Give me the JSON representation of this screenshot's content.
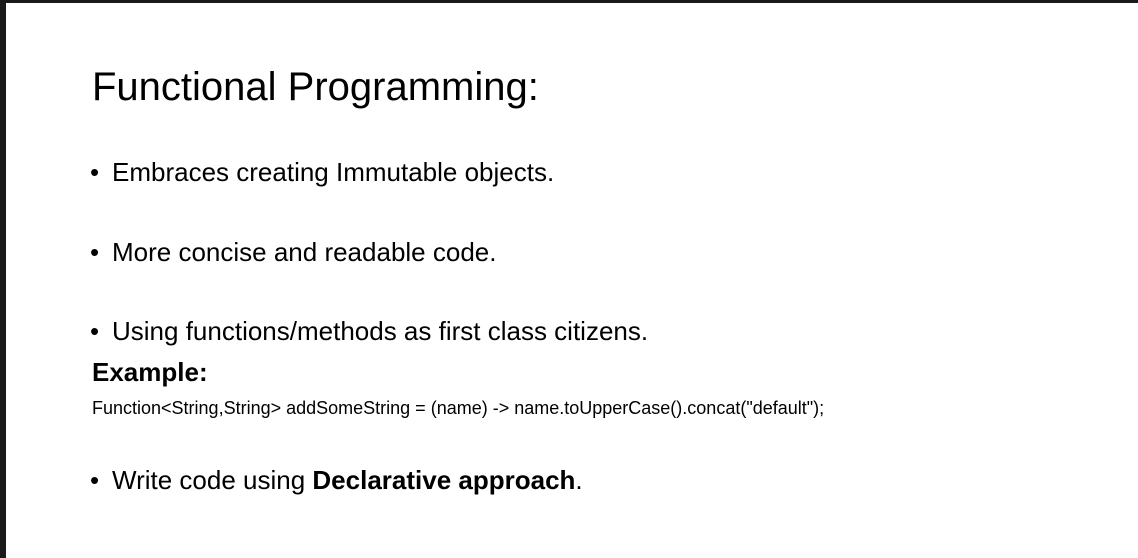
{
  "slide": {
    "title": "Functional Programming:",
    "bullets": [
      "Embraces creating Immutable objects.",
      "More concise and readable code.",
      "Using functions/methods as first class citizens."
    ],
    "example_label": "Example:",
    "code": "Function<String,String> addSomeString =  (name) -> name.toUpperCase().concat(\"default\");",
    "last_bullet": {
      "prefix": "Write code using ",
      "bold": "Declarative approach",
      "suffix": "."
    },
    "bullet_glyph": "•"
  },
  "colors": {
    "background": "#ffffff",
    "text": "#000000",
    "frame": "#1a1a1a"
  }
}
